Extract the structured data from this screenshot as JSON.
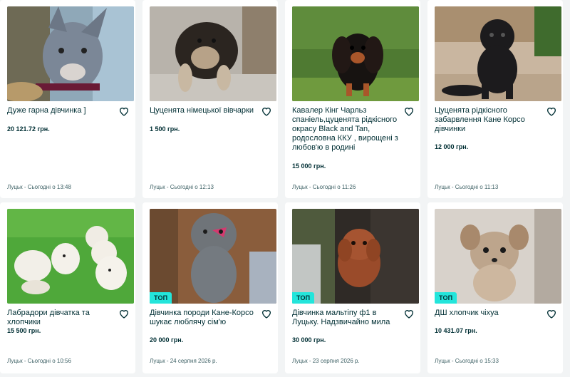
{
  "listings": [
    {
      "title": "Дуже гарна дівчинка ]",
      "price": "20 121.72 грн.",
      "location": "Луцьк - Сьогодні о 13:48",
      "badge": ""
    },
    {
      "title": "Цуценята німецької вівчарки",
      "price": "1 500 грн.",
      "location": "Луцьк - Сьогодні о 12:13",
      "badge": ""
    },
    {
      "title": "Кавалер Кінг Чарльз спаніель,цуценята рідкісного окрасу Black and Tan, родословна ККУ , вирощені з любов'ю в родині",
      "price": "15 000 грн.",
      "location": "Луцьк - Сьогодні о 11:26",
      "badge": ""
    },
    {
      "title": "Цуценята рідкісного забарвлення Кане Корсо дівчинки",
      "price": "12 000 грн.",
      "location": "Луцьк - Сьогодні о 11:13",
      "badge": ""
    },
    {
      "title": "Лабрадори дівчатка та хлопчики",
      "price": "15 500 грн.",
      "location": "Луцьк - Сьогодні о 10:56",
      "badge": ""
    },
    {
      "title": "Дівчинка породи Кане-Корсо шукає люблячу сім'ю",
      "price": "20 000 грн.",
      "location": "Луцьк - 24 серпня 2026 р.",
      "badge": "ТОП"
    },
    {
      "title": "Дівчинка мальтіпу ф1 в Луцьку. Надзвичайно мила",
      "price": "30 000 грн.",
      "location": "Луцьк - 23 серпня 2026 р.",
      "badge": "ТОП"
    },
    {
      "title": "ДШ хлопчик чіхуа",
      "price": "10 431.07 грн.",
      "location": "Луцьк - Сьогодні о 15:33",
      "badge": "ТОП"
    }
  ],
  "icons": {
    "favorite": "heart-outline-icon"
  },
  "colors": {
    "badge": "#23e5db",
    "text": "#002f34",
    "muted": "#406367"
  }
}
